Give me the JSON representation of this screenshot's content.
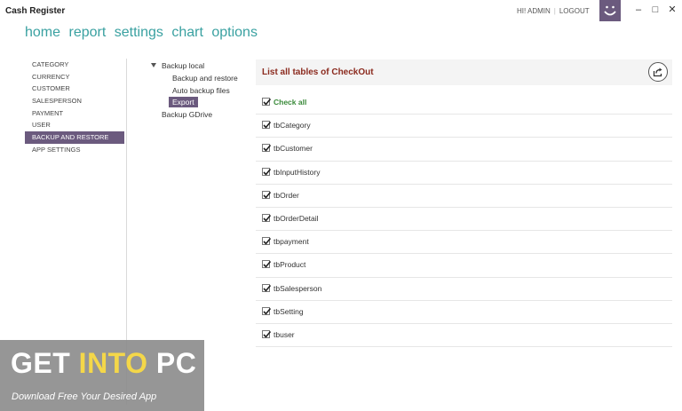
{
  "app": {
    "title": "Cash Register",
    "user_greeting": "HI! ADMIN",
    "logout_label": "LOGOUT",
    "brand_color": "#6b5a7e"
  },
  "topnav": {
    "items": [
      "home",
      "report",
      "settings",
      "chart",
      "options"
    ]
  },
  "leftmenu": {
    "items": [
      "CATEGORY",
      "CURRENCY",
      "CUSTOMER",
      "SALESPERSON",
      "PAYMENT",
      "USER",
      "BACKUP AND RESTORE",
      "APP SETTINGS"
    ],
    "active": "BACKUP AND RESTORE"
  },
  "tree": {
    "root_local": "Backup local",
    "children": [
      "Backup and restore",
      "Auto backup files",
      "Export"
    ],
    "selected": "Export",
    "root_gdrive": "Backup GDrive"
  },
  "panel": {
    "title": "List all tables of CheckOut",
    "export_icon": "share-export-icon",
    "check_all": "Check all",
    "tables": [
      "tbCategory",
      "tbCustomer",
      "tbInputHistory",
      "tbOrder",
      "tbOrderDetail",
      "tbpayment",
      "tbProduct",
      "tbSalesperson",
      "tbSetting",
      "tbuser"
    ]
  },
  "watermark": {
    "get": "GET",
    "into": "INTO",
    "pc": "PC",
    "tagline": "Download Free Your Desired App"
  }
}
